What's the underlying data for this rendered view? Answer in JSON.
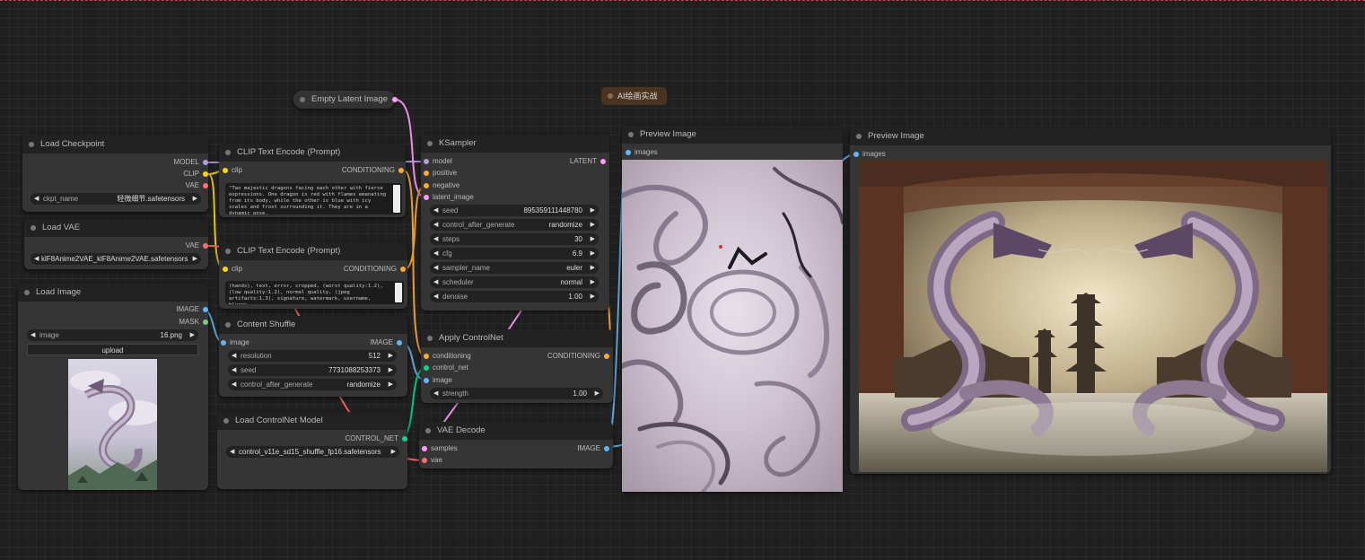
{
  "group": {
    "title": "AI绘画实战"
  },
  "nodes": {
    "load_checkpoint": {
      "title": "Load Checkpoint",
      "outputs": [
        "MODEL",
        "CLIP",
        "VAE"
      ],
      "ckpt_label": "ckpt_name",
      "ckpt_value": "轻微细节.safetensors"
    },
    "load_vae": {
      "title": "Load VAE",
      "outputs": [
        "VAE"
      ],
      "vae_value": "klF8Anime2VAE_klF8Anime2VAE.safetensors"
    },
    "load_image": {
      "title": "Load Image",
      "outputs": [
        "IMAGE",
        "MASK"
      ],
      "image_label": "image",
      "image_value": "16.png",
      "upload_label": "upload"
    },
    "clip_pos": {
      "title": "CLIP Text Encode (Prompt)",
      "input": "clip",
      "output": "CONDITIONING",
      "text": "\"Two majestic dragons facing each other with fierce expressions. One dragon is red with flames emanating from its body, while the other is blue with icy scales and frost surrounding it. They are in a dynamic pose."
    },
    "clip_neg": {
      "title": "CLIP Text Encode (Prompt)",
      "input": "clip",
      "output": "CONDITIONING",
      "text": "(hands), text, error, cropped, (worst quality:1.2), (low quality:1.2), normal quality, (jpeg artifacts:1.3), signature, watermark, username, blurry,"
    },
    "empty_latent": {
      "title": "Empty Latent Image"
    },
    "content_shuffle": {
      "title": "Content Shuffle",
      "input": "image",
      "output": "IMAGE",
      "resolution_label": "resolution",
      "resolution_value": "512",
      "seed_label": "seed",
      "seed_value": "7731088253373",
      "cag_label": "control_after_generate",
      "cag_value": "randomize"
    },
    "load_controlnet": {
      "title": "Load ControlNet Model",
      "output": "CONTROL_NET",
      "value": "control_v11e_sd15_shuffle_fp16.safetensors"
    },
    "ksampler": {
      "title": "KSampler",
      "inputs": [
        "model",
        "positive",
        "negative",
        "latent_image"
      ],
      "output": "LATENT",
      "widgets": [
        {
          "label": "seed",
          "value": "895359111448780"
        },
        {
          "label": "control_after_generate",
          "value": "randomize"
        },
        {
          "label": "steps",
          "value": "30"
        },
        {
          "label": "cfg",
          "value": "6.9"
        },
        {
          "label": "sampler_name",
          "value": "euler"
        },
        {
          "label": "scheduler",
          "value": "normal"
        },
        {
          "label": "denoise",
          "value": "1.00"
        }
      ]
    },
    "apply_controlnet": {
      "title": "Apply ControlNet",
      "inputs": [
        "conditioning",
        "control_net",
        "image"
      ],
      "output": "CONDITIONING",
      "strength_label": "strength",
      "strength_value": "1.00"
    },
    "vae_decode": {
      "title": "VAE Decode",
      "inputs": [
        "samples",
        "vae"
      ],
      "output": "IMAGE"
    },
    "preview1": {
      "title": "Preview Image",
      "input": "images"
    },
    "preview2": {
      "title": "Preview Image",
      "input": "images"
    }
  },
  "colors": {
    "model": "#b39ddb",
    "clip": "#ffd500",
    "vae": "#ff6e6e",
    "conditioning": "#ffa931",
    "latent": "#ff9cf9",
    "image": "#64b5f6",
    "mask": "#81c784",
    "control_net": "#00d78d"
  }
}
